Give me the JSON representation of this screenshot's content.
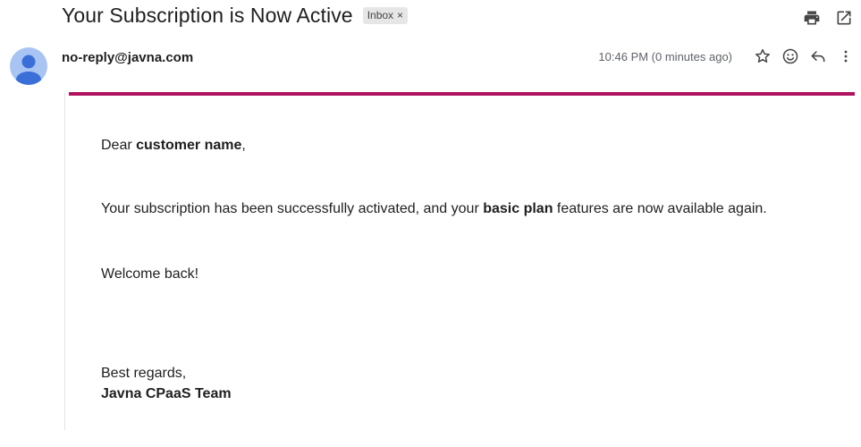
{
  "email": {
    "subject": "Your Subscription is Now Active",
    "label": "Inbox",
    "label_remove": "×",
    "sender": "no-reply@javna.com",
    "timestamp": "10:46 PM (0 minutes ago)"
  },
  "icons": {
    "print": "print-icon",
    "open_new_window": "open-in-new-window-icon",
    "star": "star-icon",
    "emoji": "emoji-react-icon",
    "reply": "reply-icon",
    "more": "more-vert-icon",
    "avatar": "person-avatar-icon"
  },
  "colors": {
    "accent_bar": "#b1125f",
    "avatar_bg": "#a7c4f2",
    "avatar_fg": "#3b6fd8"
  },
  "body": {
    "greeting_prefix": "Dear ",
    "customer_name": "customer name",
    "greeting_suffix": ",",
    "line1_prefix": "Your subscription has been successfully activated, and your ",
    "plan_name": "basic plan",
    "line1_suffix": " features are now available again.",
    "welcome": "Welcome back!",
    "closing": "Best regards,",
    "signature": "Javna CPaaS Team"
  }
}
